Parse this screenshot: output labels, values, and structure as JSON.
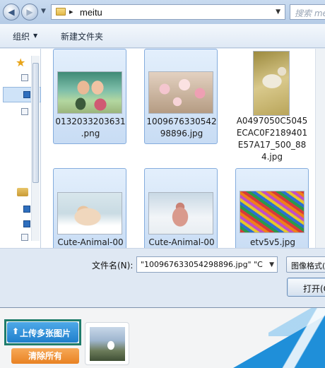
{
  "dialog": {
    "address": {
      "folder": "meitu",
      "separator": "▸"
    },
    "search": {
      "placeholder": "搜索 meitu"
    },
    "toolbar": {
      "organize": "组织",
      "new_folder": "新建文件夹"
    },
    "files": [
      {
        "name": "0132033203631.png",
        "lines": [
          "0132033203631",
          ".png"
        ],
        "selected": true,
        "thumb": "kissing-kids-photo"
      },
      {
        "name": "100967633054298896.jpg",
        "lines": [
          "1009676330542",
          "98896.jpg"
        ],
        "selected": true,
        "thumb": "roses-photo"
      },
      {
        "name": "A0497050C5045ECAC0F2189401E57A17_500_884.jpg",
        "lines": [
          "A0497050C5045",
          "ECAC0F2189401",
          "E57A17_500_88",
          "4.jpg"
        ],
        "selected": false,
        "thumb": "goat-photo"
      },
      {
        "name": "Cute-Animal-00",
        "lines": [
          "Cute-Animal-00"
        ],
        "selected": true,
        "thumb": "hamster-photo"
      },
      {
        "name": "Cute-Animal-00",
        "lines": [
          "Cute-Animal-00"
        ],
        "selected": true,
        "thumb": "chihuahua-photo"
      },
      {
        "name": "etv5v5.jpg",
        "lines": [
          "etv5v5.jpg"
        ],
        "selected": true,
        "thumb": "paperclips-photo"
      }
    ],
    "filename": {
      "label": "文件名(N):",
      "value": "\"100967633054298896.jpg\" \"C"
    },
    "filetype": {
      "label": "图像格式("
    },
    "open_button": {
      "label": "打开(O"
    }
  },
  "page": {
    "upload_button": {
      "label": "上传多张图片",
      "icon": "upload-arrow-icon"
    },
    "clear_button": {
      "label": "清除所有"
    },
    "preview": {
      "thumb": "bird-photo"
    }
  }
}
